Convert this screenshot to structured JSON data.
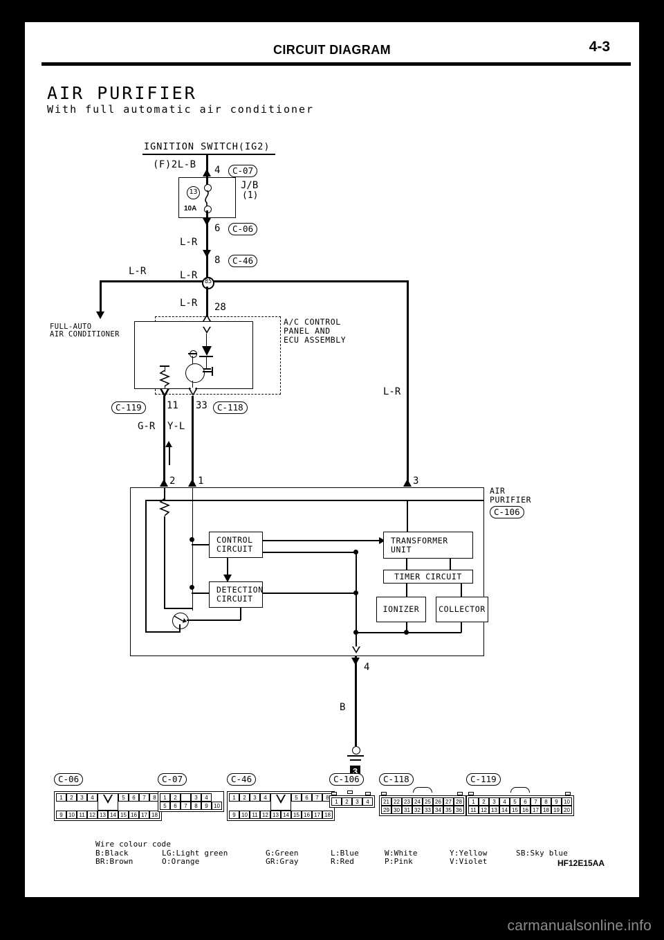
{
  "header": {
    "title": "CIRCUIT DIAGRAM",
    "page_number": "4-3"
  },
  "section": {
    "title": "AIR PURIFIER",
    "subtitle": "With full automatic air conditioner"
  },
  "source_watermark": "carmanualsonline.info",
  "document_code": "HF12E15AA",
  "circuit": {
    "ignition_switch_label": "IGNITION SWITCH(IG2)",
    "supply_wire_label": "(F)2L-B",
    "jb_label": "J/B",
    "jb_sub": "(1)",
    "fuse_number": "13",
    "fuse_rating": "10A",
    "junction_node": "85",
    "pins": {
      "ign_out": "4",
      "jb_out": "6",
      "c46": "8",
      "ac_panel_28": "28",
      "c119_pin": "11",
      "c118_pin": "33",
      "purifier_2": "2",
      "purifier_1": "1",
      "purifier_3": "3",
      "purifier_4": "4"
    },
    "connector_tags": {
      "c07": "C-07",
      "c06": "C-06",
      "c46": "C-46",
      "c119": "C-119",
      "c118": "C-118",
      "c106": "C-106"
    },
    "wires": {
      "lr_top": "L-R",
      "lr_mid": "L-R",
      "lr_branch": "L-R",
      "lr_under_node": "L-R",
      "lr_right": "L-R",
      "gr": "G-R",
      "yl": "Y-L",
      "ground_wire": "B"
    },
    "ac_unit_label_1": "FULL-AUTO",
    "ac_unit_label_2": "AIR CONDITIONER",
    "ac_panel_label_1": "A/C CONTROL",
    "ac_panel_label_2": "PANEL AND",
    "ac_panel_label_3": "ECU ASSEMBLY",
    "purifier_label_1": "AIR",
    "purifier_label_2": "PURIFIER",
    "blocks": {
      "control_circuit_l1": "CONTROL",
      "control_circuit_l2": "CIRCUIT",
      "detection_circuit_l1": "DETECTION",
      "detection_circuit_l2": "CIRCUIT",
      "transformer_l1": "TRANSFORMER",
      "transformer_l2": "UNIT",
      "timer_circuit": "TIMER CIRCUIT",
      "ionizer": "IONIZER",
      "collector": "COLLECTOR"
    },
    "ground_badge": "3"
  },
  "connectors": [
    {
      "id": "C-06",
      "style": "two-row-notch",
      "top": [
        "1",
        "2",
        "3",
        "4",
        "NOTCH",
        "5",
        "6",
        "7",
        "8"
      ],
      "bottom": [
        "9",
        "10",
        "11",
        "12",
        "13",
        "14",
        "15",
        "16",
        "17",
        "18"
      ]
    },
    {
      "id": "C-07",
      "style": "two-row-gap",
      "top": [
        "1",
        "2",
        "GAP",
        "3",
        "4"
      ],
      "bottom": [
        "5",
        "6",
        "7",
        "8",
        "9",
        "10"
      ]
    },
    {
      "id": "C-46",
      "style": "two-row-notch",
      "top": [
        "1",
        "2",
        "3",
        "4",
        "NOTCH",
        "5",
        "6",
        "7",
        "8"
      ],
      "bottom": [
        "9",
        "10",
        "11",
        "12",
        "13",
        "14",
        "15",
        "16",
        "17",
        "18"
      ]
    },
    {
      "id": "C-106",
      "style": "single-row",
      "top": [
        "1",
        "2",
        "3",
        "4"
      ],
      "bottom": []
    },
    {
      "id": "C-118",
      "style": "two-row-arc",
      "top": [
        "21",
        "22",
        "23",
        "24",
        "25",
        "26",
        "27",
        "28"
      ],
      "bottom": [
        "29",
        "30",
        "31",
        "32",
        "33",
        "34",
        "35",
        "36"
      ]
    },
    {
      "id": "C-119",
      "style": "two-row-arc",
      "top": [
        "1",
        "2",
        "3",
        "4",
        "5",
        "6",
        "7",
        "8",
        "9",
        "10"
      ],
      "bottom": [
        "11",
        "12",
        "13",
        "14",
        "15",
        "16",
        "17",
        "18",
        "19",
        "20"
      ]
    }
  ],
  "wire_colour_code": {
    "title": "Wire colour code",
    "row1": [
      "B:Black",
      "LG:Light green",
      "G:Green",
      "L:Blue",
      "W:White",
      "Y:Yellow",
      "SB:Sky blue"
    ],
    "row2": [
      "BR:Brown",
      "O:Orange",
      "GR:Gray",
      "R:Red",
      "P:Pink",
      "V:Violet",
      ""
    ]
  }
}
